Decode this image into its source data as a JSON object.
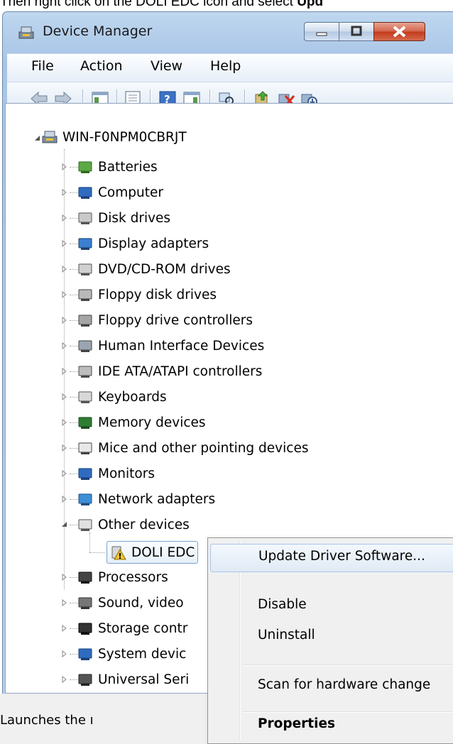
{
  "caption": {
    "prefix": "Then right click on the DOLI EDC icon and select ",
    "bold": "Upd"
  },
  "window": {
    "title": "Device Manager"
  },
  "menu": [
    "File",
    "Action",
    "View",
    "Help"
  ],
  "toolbar_icons": [
    "back-icon",
    "forward-icon",
    "console-tree-icon",
    "properties-icon",
    "help-icon",
    "action-pane-icon",
    "scan-hardware-icon",
    "update-driver-icon",
    "uninstall-icon",
    "disable-icon"
  ],
  "tree": {
    "root": "WIN-F0NPM0CBRJT",
    "categories": [
      {
        "label": "Batteries",
        "icon": "battery-icon"
      },
      {
        "label": "Computer",
        "icon": "computer-icon"
      },
      {
        "label": "Disk drives",
        "icon": "disk-drive-icon"
      },
      {
        "label": "Display adapters",
        "icon": "display-adapter-icon"
      },
      {
        "label": "DVD/CD-ROM drives",
        "icon": "dvd-drive-icon"
      },
      {
        "label": "Floppy disk drives",
        "icon": "floppy-disk-icon"
      },
      {
        "label": "Floppy drive controllers",
        "icon": "floppy-controller-icon"
      },
      {
        "label": "Human Interface Devices",
        "icon": "hid-icon"
      },
      {
        "label": "IDE ATA/ATAPI controllers",
        "icon": "ide-controller-icon"
      },
      {
        "label": "Keyboards",
        "icon": "keyboard-icon"
      },
      {
        "label": "Memory devices",
        "icon": "memory-icon"
      },
      {
        "label": "Mice and other pointing devices",
        "icon": "mouse-icon"
      },
      {
        "label": "Monitors",
        "icon": "monitor-icon"
      },
      {
        "label": "Network adapters",
        "icon": "network-adapter-icon"
      },
      {
        "label": "Other devices",
        "icon": "other-devices-icon"
      }
    ],
    "child": {
      "label": "DOLI EDC",
      "icon": "warning-device-icon"
    },
    "after": [
      {
        "label": "Processors",
        "icon": "processor-icon"
      },
      {
        "label": "Sound, video",
        "icon": "speaker-icon"
      },
      {
        "label": "Storage contr",
        "icon": "storage-icon"
      },
      {
        "label": "System devic",
        "icon": "system-device-icon"
      },
      {
        "label": "Universal Seri",
        "icon": "usb-icon"
      }
    ]
  },
  "status": "Launches the ı",
  "context_menu": {
    "update": "Update Driver Software...",
    "disable": "Disable",
    "uninstall": "Uninstall",
    "scan": "Scan for hardware change",
    "properties": "Properties"
  },
  "colors": {
    "accent": "#7da2ce",
    "window_frame": "#a8c5e6",
    "close": "#c23a1c"
  }
}
